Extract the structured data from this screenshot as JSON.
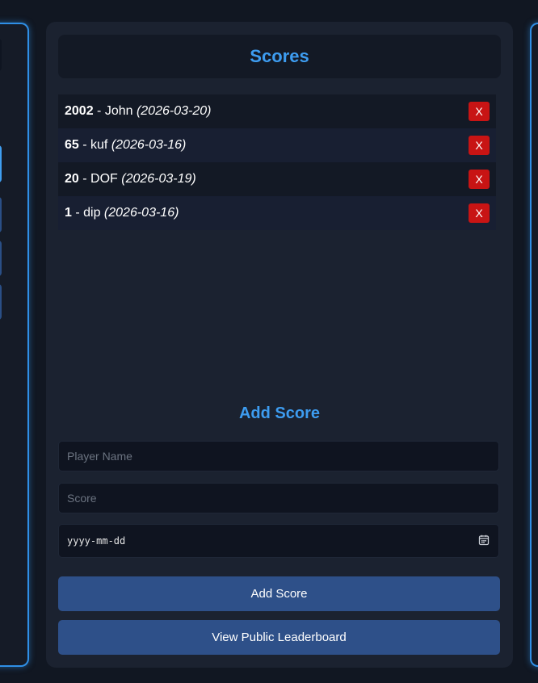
{
  "header": {
    "title": "Scores"
  },
  "scores": [
    {
      "score": "2002",
      "sep": " - ",
      "name": "John ",
      "date": "(2026-03-20)",
      "delete_label": "X"
    },
    {
      "score": "65",
      "sep": " - ",
      "name": "kuf ",
      "date": "(2026-03-16)",
      "delete_label": "X"
    },
    {
      "score": "20",
      "sep": " - ",
      "name": "DOF ",
      "date": "(2026-03-19)",
      "delete_label": "X"
    },
    {
      "score": "1",
      "sep": " - ",
      "name": "dip ",
      "date": "(2026-03-16)",
      "delete_label": "X"
    }
  ],
  "form": {
    "title": "Add Score",
    "player_placeholder": "Player Name",
    "score_placeholder": "Score",
    "date_placeholder": "yyyy-mm-dd",
    "date_icon": "calendar-icon",
    "add_button": "Add Score",
    "view_button": "View Public Leaderboard"
  },
  "colors": {
    "accent": "#3d9cf0",
    "delete": "#c81414",
    "button": "#2e5089",
    "panel": "#1b2230",
    "background": "#111722"
  }
}
